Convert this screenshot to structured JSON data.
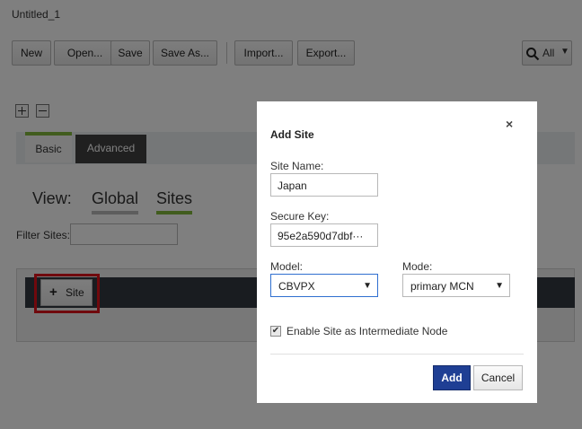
{
  "window": {
    "title": "Untitled_1"
  },
  "toolbar": {
    "new": "New",
    "open": "Open...",
    "save": "Save",
    "save_as": "Save As...",
    "import": "Import...",
    "export": "Export...",
    "search_scope": "All"
  },
  "tabs": {
    "basic": "Basic",
    "advanced": "Advanced"
  },
  "view": {
    "label": "View:",
    "global": "Global",
    "sites": "Sites"
  },
  "filter": {
    "label": "Filter Sites:",
    "value": ""
  },
  "site_button": {
    "label": "Site"
  },
  "dialog": {
    "title": "Add Site",
    "close_glyph": "×",
    "site_name_label": "Site Name:",
    "site_name_value": "Japan",
    "secure_key_label": "Secure Key:",
    "secure_key_value": "95e2a590d7dbf···",
    "model_label": "Model:",
    "model_value": "CBVPX",
    "mode_label": "Mode:",
    "mode_value": "primary MCN",
    "checkbox_label": "Enable Site as Intermediate Node",
    "checkbox_checked": true,
    "add_label": "Add",
    "cancel_label": "Cancel"
  },
  "colors": {
    "accent_green": "#82b93d",
    "primary_button": "#1f3f94",
    "highlight_red": "#e0131b",
    "dark_tab": "#404040"
  }
}
